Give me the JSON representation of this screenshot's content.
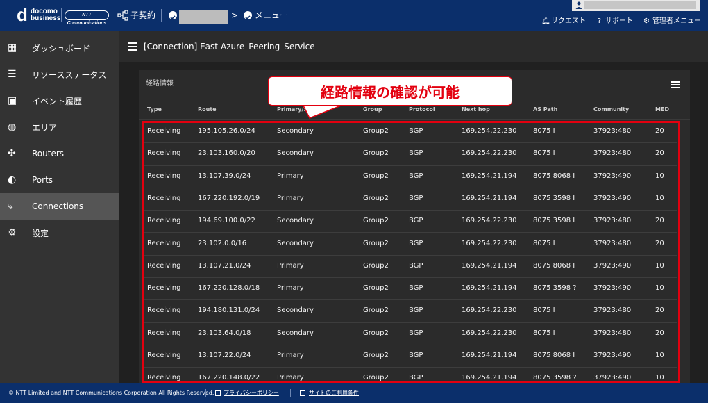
{
  "header": {
    "logo_d": "d",
    "logo_line1": "docomo",
    "logo_line2": "business",
    "ntt_badge": "NTT Communications",
    "sub_account": "子契約",
    "chevron": ">",
    "menu_label": "メニュー",
    "links": [
      {
        "icon": "bell-icon",
        "label": "リクエスト"
      },
      {
        "icon": "question-icon",
        "label": "サポート"
      },
      {
        "icon": "gear-icon",
        "label": "管理者メニュー"
      }
    ]
  },
  "sidebar": {
    "items": [
      {
        "icon": "grid-icon",
        "glyph": "▦",
        "label": "ダッシュボード",
        "active": false
      },
      {
        "icon": "checklist-icon",
        "glyph": "☰",
        "label": "リソースステータス",
        "active": false
      },
      {
        "icon": "calendar-check-icon",
        "glyph": "▣",
        "label": "イベント履歴",
        "active": false
      },
      {
        "icon": "globe-icon",
        "glyph": "◍",
        "label": "エリア",
        "active": false
      },
      {
        "icon": "router-icon",
        "glyph": "✣",
        "label": "Routers",
        "active": false
      },
      {
        "icon": "toggle-icon",
        "glyph": "◐",
        "label": "Ports",
        "active": false
      },
      {
        "icon": "connection-icon",
        "glyph": "⤷",
        "label": "Connections",
        "active": true
      },
      {
        "icon": "gear-icon",
        "glyph": "⚙",
        "label": "設定",
        "active": false
      }
    ]
  },
  "page": {
    "title": "[Connection] East-Azure_Peering_Service"
  },
  "panel": {
    "title": "経路情報"
  },
  "callout": {
    "text": "経路情報の確認が可能",
    "border_color": "#e3000f"
  },
  "table": {
    "headers": [
      "Type",
      "Route",
      "Primary/Se",
      "Group",
      "Protocol",
      "Next hop",
      "AS Path",
      "Community",
      "MED"
    ],
    "rows": [
      [
        "Receiving",
        "195.105.26.0/24",
        "Secondary",
        "Group2",
        "BGP",
        "169.254.22.230",
        "8075 I",
        "37923:480",
        "20"
      ],
      [
        "Receiving",
        "23.103.160.0/20",
        "Secondary",
        "Group2",
        "BGP",
        "169.254.22.230",
        "8075 I",
        "37923:480",
        "20"
      ],
      [
        "Receiving",
        "13.107.39.0/24",
        "Primary",
        "Group2",
        "BGP",
        "169.254.21.194",
        "8075 8068 I",
        "37923:490",
        "10"
      ],
      [
        "Receiving",
        "167.220.192.0/19",
        "Primary",
        "Group2",
        "BGP",
        "169.254.21.194",
        "8075 3598 I",
        "37923:490",
        "10"
      ],
      [
        "Receiving",
        "194.69.100.0/22",
        "Secondary",
        "Group2",
        "BGP",
        "169.254.22.230",
        "8075 3598 I",
        "37923:480",
        "20"
      ],
      [
        "Receiving",
        "23.102.0.0/16",
        "Secondary",
        "Group2",
        "BGP",
        "169.254.22.230",
        "8075 I",
        "37923:480",
        "20"
      ],
      [
        "Receiving",
        "13.107.21.0/24",
        "Primary",
        "Group2",
        "BGP",
        "169.254.21.194",
        "8075 8068 I",
        "37923:490",
        "10"
      ],
      [
        "Receiving",
        "167.220.128.0/18",
        "Primary",
        "Group2",
        "BGP",
        "169.254.21.194",
        "8075 3598 ?",
        "37923:490",
        "10"
      ],
      [
        "Receiving",
        "194.180.131.0/24",
        "Secondary",
        "Group2",
        "BGP",
        "169.254.22.230",
        "8075 I",
        "37923:480",
        "20"
      ],
      [
        "Receiving",
        "23.103.64.0/18",
        "Secondary",
        "Group2",
        "BGP",
        "169.254.22.230",
        "8075 I",
        "37923:480",
        "20"
      ],
      [
        "Receiving",
        "13.107.22.0/24",
        "Primary",
        "Group2",
        "BGP",
        "169.254.21.194",
        "8075 8068 I",
        "37923:490",
        "10"
      ],
      [
        "Receiving",
        "167.220.148.0/22",
        "Primary",
        "Group2",
        "BGP",
        "169.254.21.194",
        "8075 3598 ?",
        "37923:490",
        "10"
      ]
    ]
  },
  "footer": {
    "copyright": "© NTT Limited and NTT Communications Corporation All Rights Reserved.",
    "privacy": "プライバシーポリシー",
    "terms": "サイトのご利用条件"
  },
  "colors": {
    "header_bg": "#0b2f6b",
    "sidebar_bg": "#333333",
    "sidebar_active": "#555555",
    "highlight_red": "#e3000f"
  }
}
